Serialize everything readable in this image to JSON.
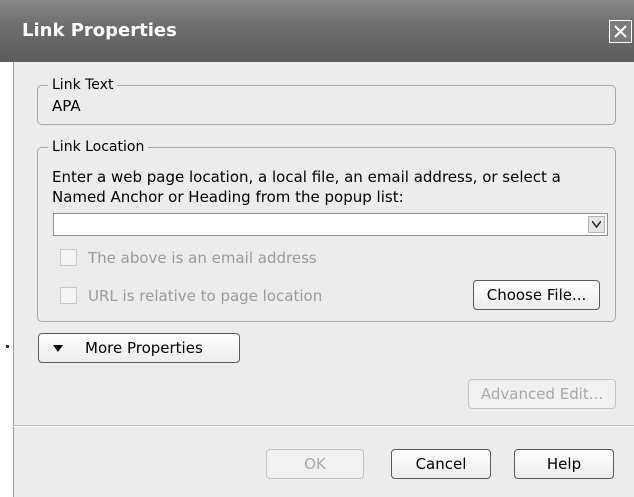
{
  "window": {
    "title": "Link Properties"
  },
  "link_text": {
    "legend": "Link Text",
    "value": "APA"
  },
  "link_location": {
    "legend": "Link Location",
    "instructions_line1": "Enter a web page location, a local file, an email address, or select a",
    "instructions_line2": "Named Anchor or Heading from the popup list:",
    "combo_value": "",
    "checkbox_email_label": "The above is an email address",
    "checkbox_relative_label": "URL is relative to page location",
    "choose_file_label": "Choose File..."
  },
  "more_properties_label": "More Properties",
  "advanced_edit_label": "Advanced Edit...",
  "buttons": {
    "ok": "OK",
    "cancel": "Cancel",
    "help": "Help"
  },
  "icons": [
    "close-icon",
    "dropdown-arrow-icon",
    "triangle-down-icon"
  ]
}
